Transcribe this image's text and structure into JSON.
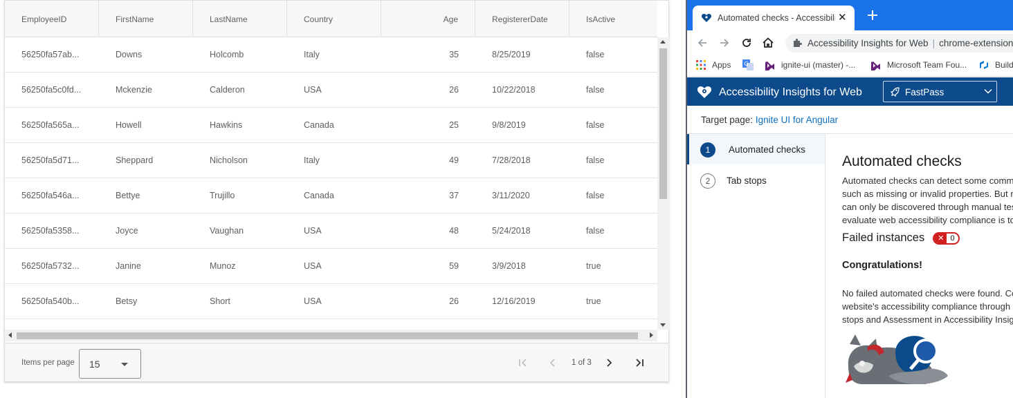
{
  "grid": {
    "columns": [
      {
        "label": "EmployeeID",
        "align": "left"
      },
      {
        "label": "FirstName",
        "align": "left"
      },
      {
        "label": "LastName",
        "align": "left"
      },
      {
        "label": "Country",
        "align": "left"
      },
      {
        "label": "Age",
        "align": "right"
      },
      {
        "label": "RegistererDate",
        "align": "left"
      },
      {
        "label": "IsActive",
        "align": "left"
      }
    ],
    "rows": [
      [
        "56250fa57ab...",
        "Downs",
        "Holcomb",
        "Italy",
        "35",
        "8/25/2019",
        "false"
      ],
      [
        "56250fa5c0fd...",
        "Mckenzie",
        "Calderon",
        "USA",
        "26",
        "10/22/2018",
        "false"
      ],
      [
        "56250fa565a...",
        "Howell",
        "Hawkins",
        "Canada",
        "25",
        "9/8/2019",
        "false"
      ],
      [
        "56250fa5d71...",
        "Sheppard",
        "Nicholson",
        "Italy",
        "49",
        "7/28/2018",
        "false"
      ],
      [
        "56250fa546a...",
        "Bettye",
        "Trujillo",
        "Canada",
        "37",
        "3/11/2020",
        "false"
      ],
      [
        "56250fa5358...",
        "Joyce",
        "Vaughan",
        "USA",
        "48",
        "5/24/2018",
        "false"
      ],
      [
        "56250fa5732...",
        "Janine",
        "Munoz",
        "USA",
        "59",
        "3/9/2018",
        "true"
      ],
      [
        "56250fa540b...",
        "Betsy",
        "Short",
        "USA",
        "26",
        "12/16/2019",
        "true"
      ]
    ]
  },
  "paginator": {
    "items_per_page_label": "Items per page",
    "items_per_page_value": "15",
    "page_info": "1 of 3"
  },
  "browser": {
    "tab_title": "Automated checks - Accessibility Insights for Web",
    "tab_close": "✕",
    "address_title": "Accessibility Insights for Web",
    "address_url": "chrome-extension://pbjjkligggfmakdaogkfomddhfmpjeni/DetailsView/detailsView.html",
    "bookmarks": [
      {
        "label": "Apps",
        "icon": "apps-grid-icon"
      },
      {
        "label": "",
        "icon": "google-translate-icon"
      },
      {
        "label": "ignite-ui (master) -...",
        "icon": "visual-studio-icon"
      },
      {
        "label": "Microsoft Team Fou...",
        "icon": "visual-studio-icon"
      },
      {
        "label": "Build",
        "icon": "azure-devops-icon"
      }
    ]
  },
  "ai": {
    "app_title": "Accessibility Insights for Web",
    "mode_label": "FastPass",
    "target_prefix": "Target page: ",
    "target_link": "Ignite UI for Angular",
    "nav": [
      {
        "num": "1",
        "label": "Automated checks"
      },
      {
        "num": "2",
        "label": "Tab stops"
      }
    ],
    "content_title": "Automated checks",
    "content_desc": "Automated checks can detect some common accessibility problems such as missing or invalid properties. But most accessibility problems can only be discovered through manual testing. The best way to evaluate web accessibility compliance is to complete an assessment.",
    "failed_label": "Failed instances",
    "failed_count": "0",
    "congrats": "Congratulations!",
    "no_failed": "No failed automated checks were found. Continue investigating your website's accessibility compliance through manual testing using Tab stops and Assessment in Accessibility Insights for Web."
  },
  "colors": {
    "tabstrip_blue": "#1a73e8",
    "ai_header_blue": "#0c4a8c",
    "link_blue": "#106ebe",
    "failed_red": "#d11f1f"
  }
}
